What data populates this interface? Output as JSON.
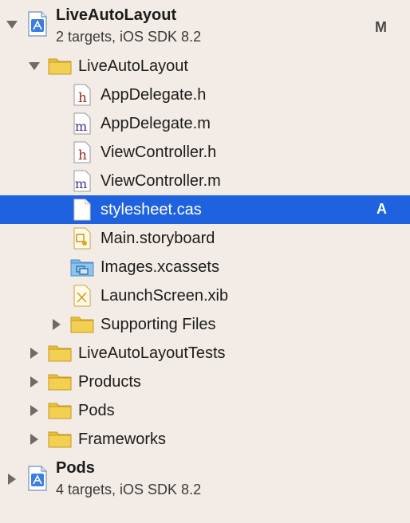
{
  "projects": [
    {
      "name": "LiveAutoLayout",
      "subtitle": "2 targets, iOS SDK 8.2",
      "badge": "M"
    },
    {
      "name": "Pods",
      "subtitle": "4 targets, iOS SDK 8.2"
    }
  ],
  "groups": {
    "main": "LiveAutoLayout",
    "supporting": "Supporting Files",
    "tests": "LiveAutoLayoutTests",
    "products": "Products",
    "pods": "Pods",
    "frameworks": "Frameworks"
  },
  "files": [
    {
      "name": "AppDelegate.h",
      "icon": "h-header-file-icon",
      "glyph": "h"
    },
    {
      "name": "AppDelegate.m",
      "icon": "m-source-file-icon",
      "glyph": "m"
    },
    {
      "name": "ViewController.h",
      "icon": "h-header-file-icon",
      "glyph": "h"
    },
    {
      "name": "ViewController.m",
      "icon": "m-source-file-icon",
      "glyph": "m"
    },
    {
      "name": "stylesheet.cas",
      "icon": "blank-file-icon",
      "badge": "A",
      "selected": true
    },
    {
      "name": "Main.storyboard",
      "icon": "storyboard-file-icon"
    },
    {
      "name": "Images.xcassets",
      "icon": "asset-catalog-icon"
    },
    {
      "name": "LaunchScreen.xib",
      "icon": "xib-file-icon"
    }
  ],
  "colors": {
    "selection": "#1f62e0",
    "background": "#f3ece6",
    "folder": "#e8c040"
  }
}
